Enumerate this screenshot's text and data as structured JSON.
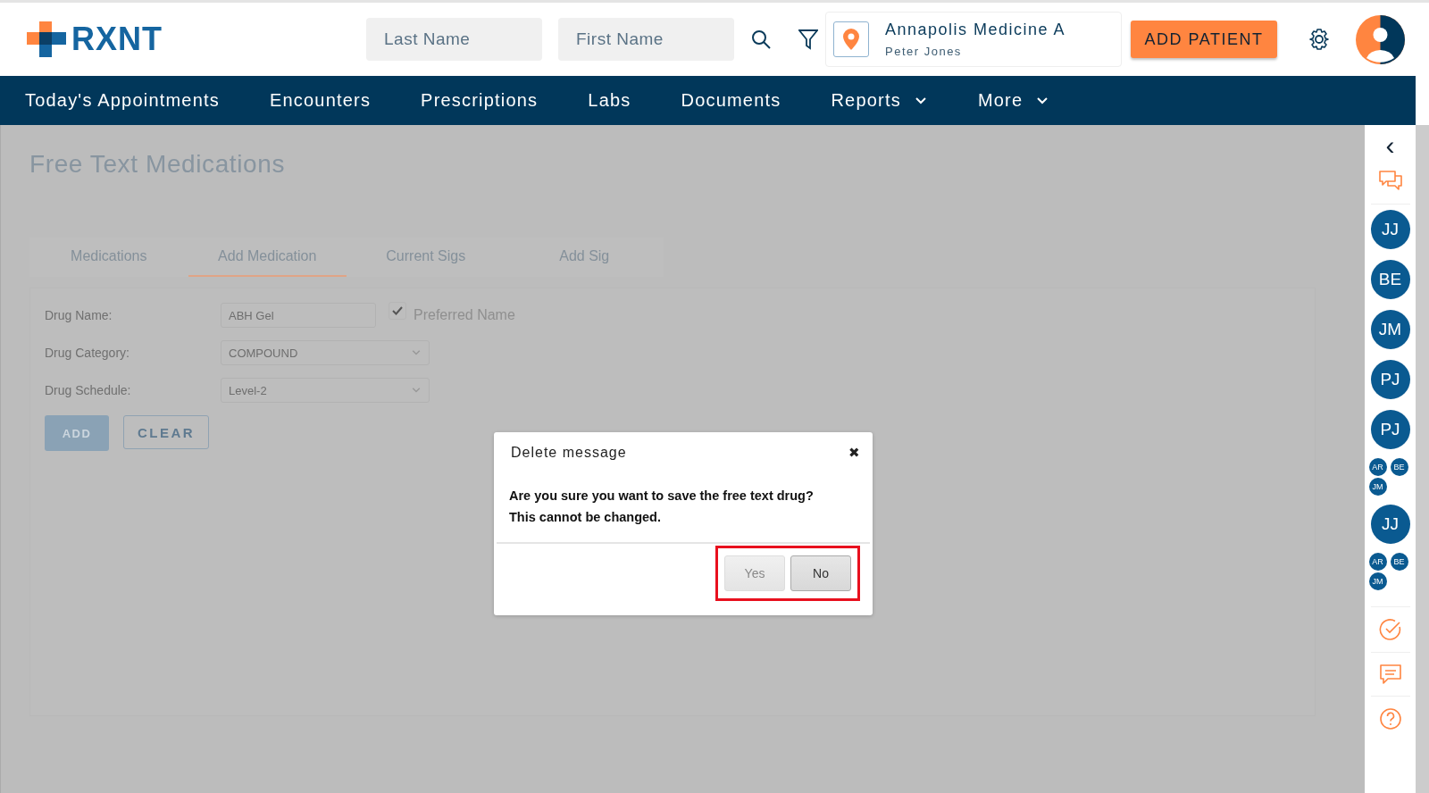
{
  "header": {
    "logo": "RXNT",
    "last_name": {
      "placeholder": "Last Name"
    },
    "first_name": {
      "placeholder": "First Name"
    },
    "location": {
      "name": "Annapolis Medicine A",
      "user": "Peter Jones"
    },
    "add_patient": "ADD PATIENT"
  },
  "nav": [
    {
      "label": "Today's Appointments",
      "dropdown": false
    },
    {
      "label": "Encounters",
      "dropdown": false
    },
    {
      "label": "Prescriptions",
      "dropdown": false
    },
    {
      "label": "Labs",
      "dropdown": false
    },
    {
      "label": "Documents",
      "dropdown": false
    },
    {
      "label": "Reports",
      "dropdown": true
    },
    {
      "label": "More",
      "dropdown": true
    }
  ],
  "page_title": "Free Text Medications",
  "tabs": [
    {
      "label": "Medications",
      "selected": false
    },
    {
      "label": "Add Medication",
      "selected": true
    },
    {
      "label": "Current Sigs",
      "selected": false
    },
    {
      "label": "Add Sig",
      "selected": false
    }
  ],
  "form": {
    "drug_name": {
      "label": "Drug Name:",
      "value": "ABH Gel"
    },
    "preferred_name": {
      "label": "Preferred Name",
      "checked": true
    },
    "drug_category": {
      "label": "Drug Category:",
      "value": "COMPOUND"
    },
    "drug_schedule": {
      "label": "Drug Schedule:",
      "value": "Level-2"
    },
    "add": "ADD",
    "clear": "CLEAR"
  },
  "dialog": {
    "title": "Delete message",
    "close": "✖",
    "lines": [
      "Are you sure you want to save the free text drug?",
      "This cannot be changed."
    ],
    "buttons_highlighted": true,
    "buttons": [
      {
        "label": "Yes",
        "focused": false
      },
      {
        "label": "No",
        "focused": true
      }
    ]
  },
  "sidebar": {
    "collapse": "‹",
    "contacts": [
      {
        "kind": "single",
        "initials": [
          "JJ"
        ]
      },
      {
        "kind": "single",
        "initials": [
          "BE"
        ]
      },
      {
        "kind": "single",
        "initials": [
          "JM"
        ]
      },
      {
        "kind": "single",
        "initials": [
          "PJ"
        ]
      },
      {
        "kind": "single",
        "initials": [
          "PJ"
        ]
      },
      {
        "kind": "group",
        "initials": [
          "AR",
          "BE",
          "JM"
        ]
      },
      {
        "kind": "single",
        "initials": [
          "JJ"
        ]
      },
      {
        "kind": "group",
        "initials": [
          "AR",
          "BE",
          "JM"
        ]
      }
    ]
  }
}
